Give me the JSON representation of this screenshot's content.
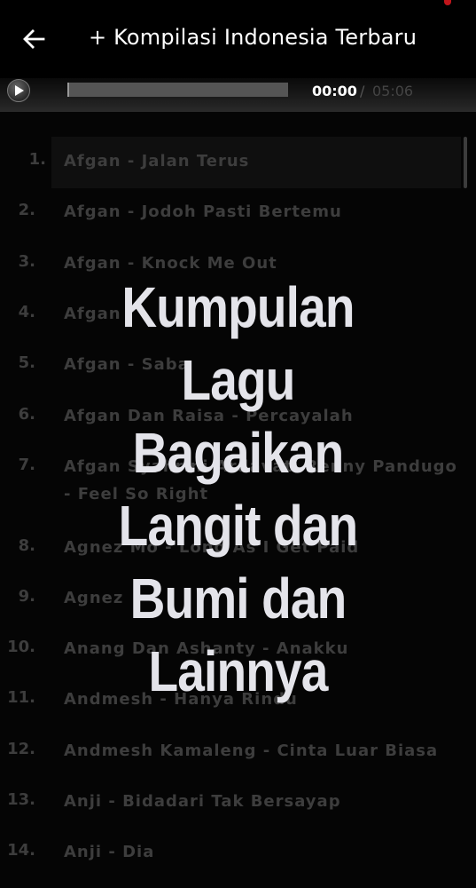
{
  "header": {
    "title": "+ Kompilasi Indonesia Terbaru",
    "back_icon": "arrow-left-icon"
  },
  "player": {
    "play_icon": "play-icon",
    "current_time": "00:00",
    "separator": "/",
    "total_time": "05:06",
    "progress": 0
  },
  "tracks": [
    {
      "num": "1.",
      "title": "Afgan - Jalan Terus"
    },
    {
      "num": "2.",
      "title": "Afgan - Jodoh Pasti Bertemu"
    },
    {
      "num": "3.",
      "title": "Afgan - Knock Me Out"
    },
    {
      "num": "4.",
      "title": "Afgan"
    },
    {
      "num": "5.",
      "title": "Afgan - Saba"
    },
    {
      "num": "6.",
      "title": "Afgan Dan Raisa - Percayalah"
    },
    {
      "num": "7.",
      "title": "Afgan Syahrini Ardavati Renny Pandugo - Feel So Right"
    },
    {
      "num": "8.",
      "title": "Agnez Mo - Long As I Get Paid"
    },
    {
      "num": "9.",
      "title": "Agnez"
    },
    {
      "num": "10.",
      "title": "Anang Dan Ashanty - Anakku"
    },
    {
      "num": "11.",
      "title": "Andmesh - Hanya Rindu"
    },
    {
      "num": "12.",
      "title": "Andmesh Kamaleng - Cinta Luar Biasa"
    },
    {
      "num": "13.",
      "title": "Anji - Bidadari Tak Bersayap"
    },
    {
      "num": "14.",
      "title": "Anji - Dia"
    }
  ],
  "overlay": {
    "lines": [
      "Kumpulan",
      "Lagu",
      "Bagaikan",
      "Langit dan",
      "Bumi dan",
      "Lainnya"
    ]
  },
  "colors": {
    "accent": "#c0151b",
    "track_text": "#3d3d3d",
    "overlay_text": "#e4e4ea"
  }
}
